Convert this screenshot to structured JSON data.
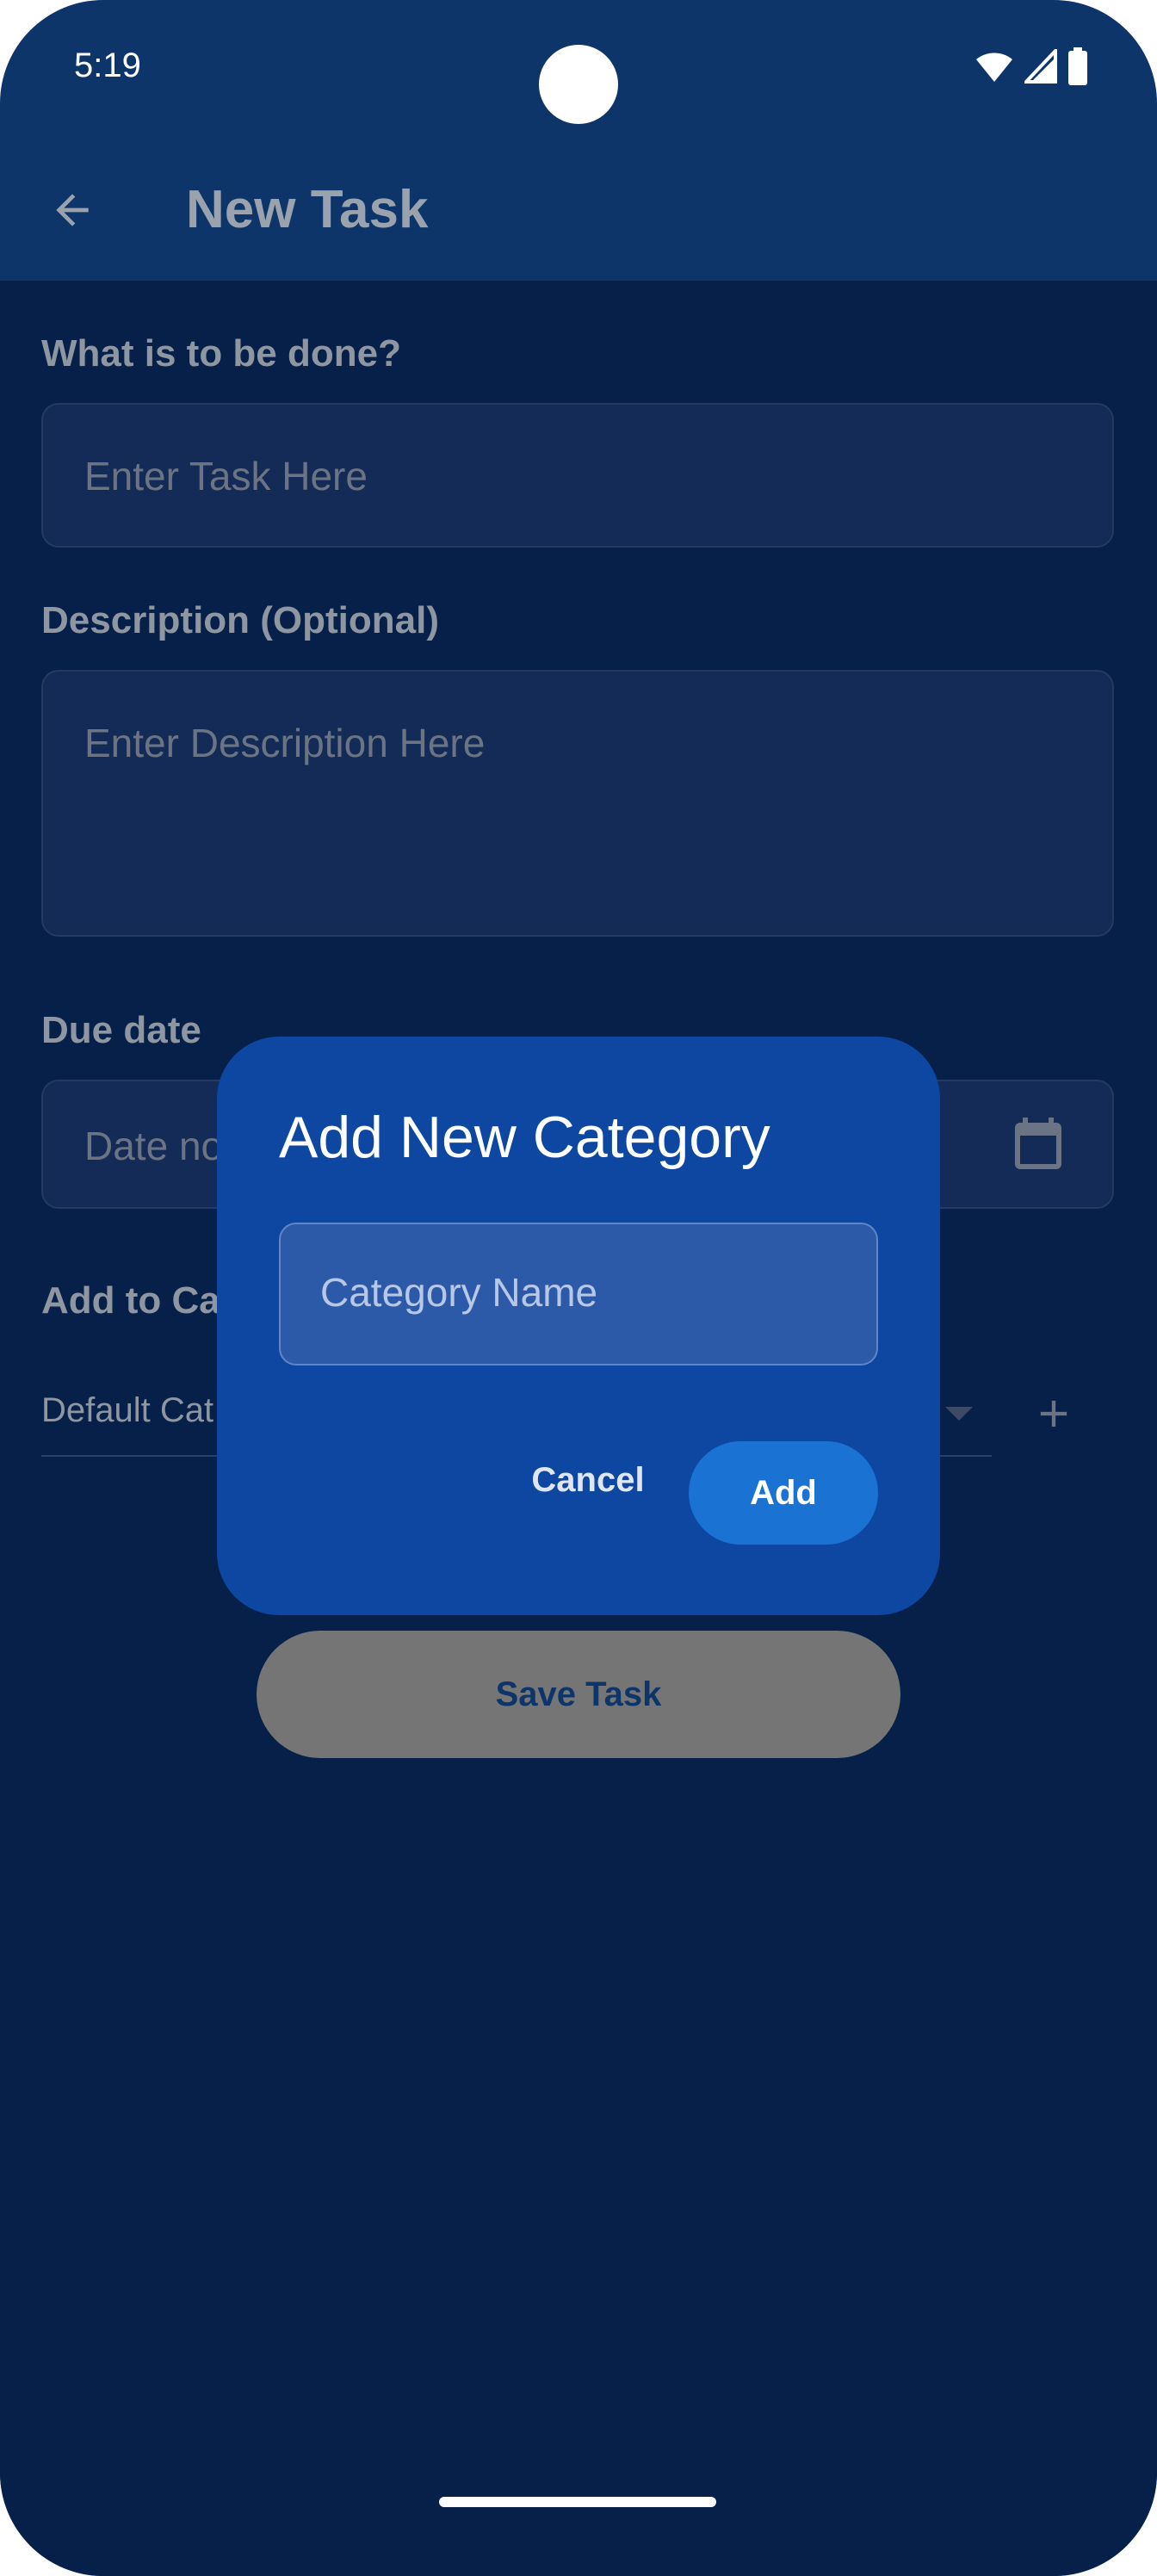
{
  "status_bar": {
    "time": "5:19"
  },
  "app_bar": {
    "title": "New Task"
  },
  "form": {
    "task_label": "What is to be done?",
    "task_placeholder": "Enter Task Here",
    "description_label": "Description (Optional)",
    "description_placeholder": "Enter Description Here",
    "due_date_label": "Due date",
    "due_date_placeholder": "Date no",
    "category_label": "Add to Ca",
    "category_value": "Default Cat",
    "save_button": "Save Task"
  },
  "dialog": {
    "title": "Add New Category",
    "input_placeholder": "Category Name",
    "cancel_label": "Cancel",
    "add_label": "Add"
  },
  "colors": {
    "app_bar": "#0e356a",
    "background": "#07204a",
    "dialog": "#0e47a1",
    "accent": "#1a72d2"
  }
}
